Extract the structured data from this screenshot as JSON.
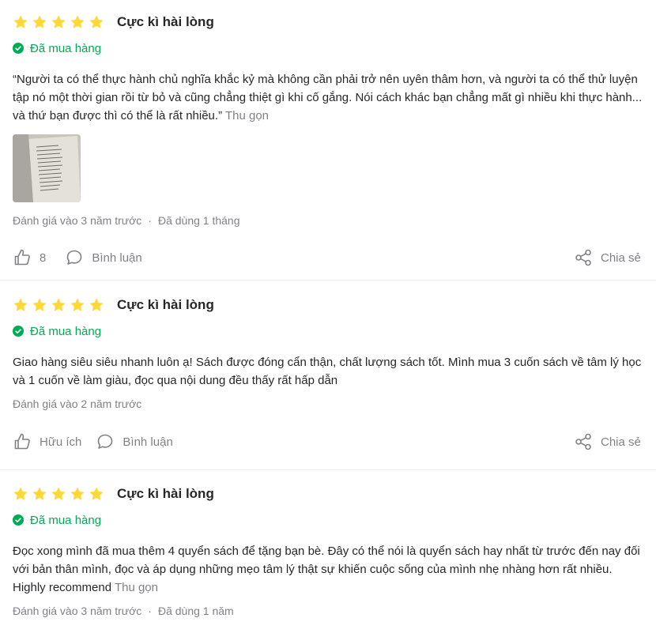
{
  "colors": {
    "star": "#fdd836",
    "bought": "#00ab56",
    "muted": "#808089",
    "text": "#27272a"
  },
  "reviews": [
    {
      "stars": 5,
      "title": "Cực kì hài lòng",
      "bought_label": "Đã mua hàng",
      "content": "“Người ta có thể thực hành chủ nghĩa khắc kỷ mà không cần phải trở nên uyên thâm hơn, và người ta có thể thử luyện tập nó một thời gian rồi từ bỏ và cũng chẳng thiệt gì khi cố gắng. Nói cách khác bạn chẳng mất gì nhiều khi thực hành... và thứ bạn được thì có thể là rất nhiều.”",
      "collapse_label": "Thu gọn",
      "rated_time": "Đánh giá vào 3 năm trước",
      "used_time": "Đã dùng 1 tháng",
      "like_label": "8",
      "comment_label": "Bình luận",
      "share_label": "Chia sẻ"
    },
    {
      "stars": 5,
      "title": "Cực kì hài lòng",
      "bought_label": "Đã mua hàng",
      "content": "Giao hàng siêu siêu nhanh luôn ạ! Sách được đóng cẩn thận, chất lượng sách tốt. Mình mua 3 cuốn sách về tâm lý học và 1 cuốn về làm giàu, đọc qua nội dung đều thấy rất hấp dẫn",
      "rated_time": "Đánh giá vào 2 năm trước",
      "like_label": "Hữu ích",
      "comment_label": "Bình luận",
      "share_label": "Chia sẻ"
    },
    {
      "stars": 5,
      "title": "Cực kì hài lòng",
      "bought_label": "Đã mua hàng",
      "content": "Đọc xong mình đã mua thêm 4 quyển sách để tặng bạn bè. Đây có thể nói là quyển sách hay nhất từ trước đến nay đối với bản thân mình, đọc và áp dụng những mẹo tâm lý thật sự khiến cuộc sống của mình nhẹ nhàng hơn rất nhiều. Highly recommend",
      "collapse_label": "Thu gọn",
      "rated_time": "Đánh giá vào 3 năm trước",
      "used_time": "Đã dùng 1 năm"
    }
  ]
}
